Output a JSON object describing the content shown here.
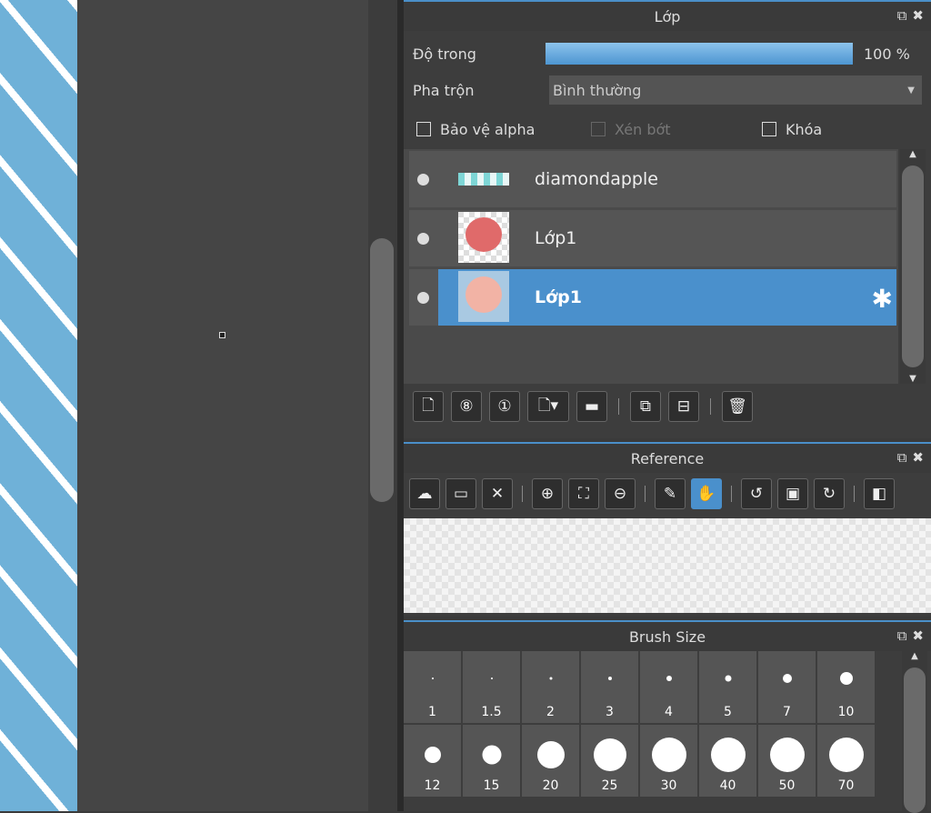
{
  "layers_panel": {
    "title": "Lớp",
    "opacity_label": "Độ trong",
    "opacity_value": "100 %",
    "opacity_fraction": 1.0,
    "blend_label": "Pha trộn",
    "blend_value": "Bình thường",
    "protect_alpha_label": "Bảo vệ alpha",
    "clipping_label": "Xén bớt",
    "lock_label": "Khóa",
    "layers": [
      {
        "name": "diamondapple",
        "selected": false
      },
      {
        "name": "Lớp1",
        "selected": false
      },
      {
        "name": "Lớp1",
        "selected": true
      }
    ]
  },
  "reference_panel": {
    "title": "Reference"
  },
  "brush_panel": {
    "title": "Brush Size",
    "sizes": [
      "1",
      "1.5",
      "2",
      "3",
      "4",
      "5",
      "7",
      "10",
      "12",
      "15",
      "20",
      "25",
      "30",
      "40",
      "50",
      "70"
    ]
  },
  "colors": {
    "accent": "#4a90cc",
    "panel_bg": "#3d3d3d",
    "canvas_bg": "#454545"
  }
}
